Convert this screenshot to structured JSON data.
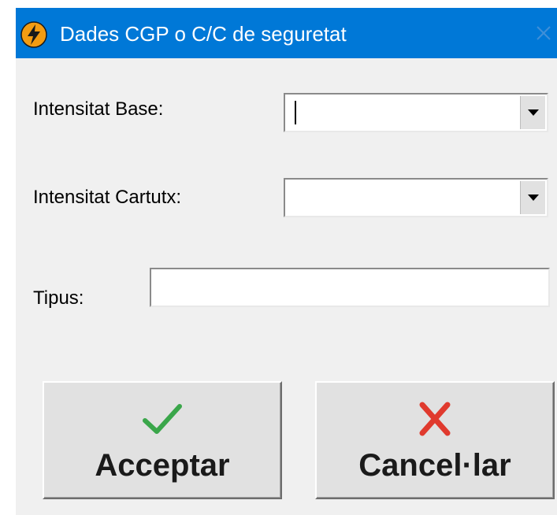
{
  "window": {
    "title": "Dades CGP o C/C de seguretat",
    "app_icon": "lightning-bolt-icon",
    "close_icon": "close-icon",
    "titlebar_color": "#0078d7"
  },
  "form": {
    "intensitat_base": {
      "label": "Intensitat Base:",
      "value": ""
    },
    "intensitat_cartutx": {
      "label": "Intensitat Cartutx:",
      "value": ""
    },
    "tipus": {
      "label": "Tipus:",
      "value": ""
    }
  },
  "buttons": {
    "accept": {
      "label": "Acceptar",
      "icon": "checkmark-icon",
      "icon_color": "#3aa64a"
    },
    "cancel": {
      "label": "Cancel·lar",
      "icon": "red-x-icon",
      "icon_color": "#e03a2e"
    }
  }
}
